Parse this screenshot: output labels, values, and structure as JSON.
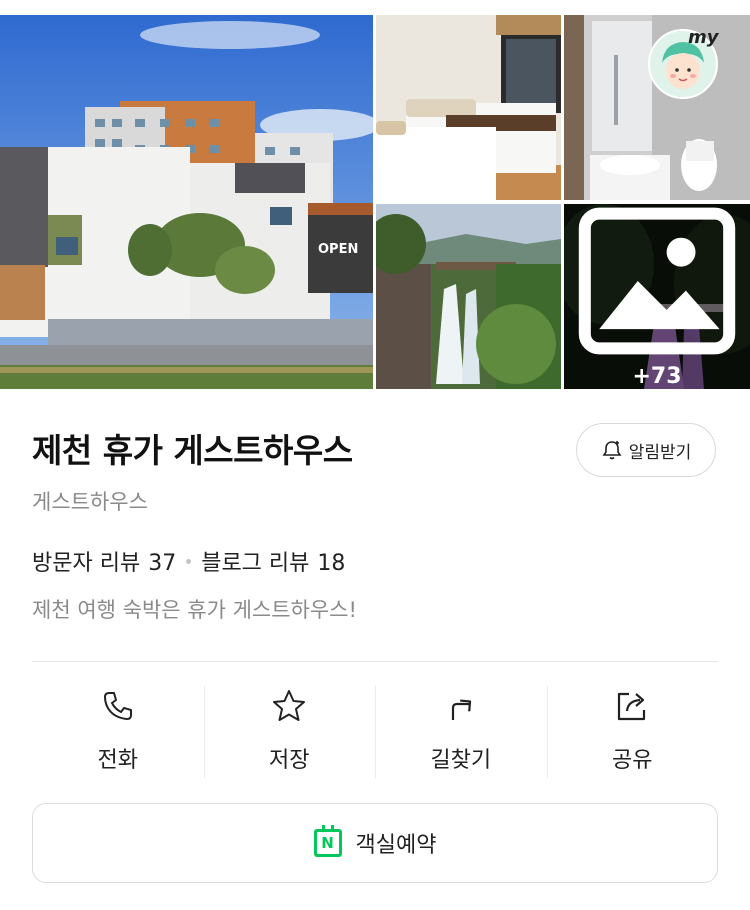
{
  "gallery": {
    "more_count": "+73",
    "badge_text": "my",
    "sign_text": "OPEN"
  },
  "place": {
    "title": "제천 휴가 게스트하우스",
    "category": "게스트하우스",
    "visitor_review_label": "방문자 리뷰",
    "visitor_review_count": "37",
    "blog_review_label": "블로그 리뷰",
    "blog_review_count": "18",
    "description": "제천 여행 숙박은 휴가 게스트하우스!"
  },
  "alarm_button": {
    "label": "알림받기",
    "icon": "bell-plus-icon"
  },
  "actions": [
    {
      "label": "전화",
      "icon": "phone-icon"
    },
    {
      "label": "저장",
      "icon": "star-icon"
    },
    {
      "label": "길찾기",
      "icon": "directions-arrow-icon"
    },
    {
      "label": "공유",
      "icon": "share-icon"
    }
  ],
  "booking_button": {
    "label": "객실예약",
    "icon_letter": "N",
    "icon": "naver-booking-icon"
  },
  "colors": {
    "accent_green": "#03c75a",
    "text_primary": "#111111",
    "text_secondary": "#8a8a8a"
  }
}
